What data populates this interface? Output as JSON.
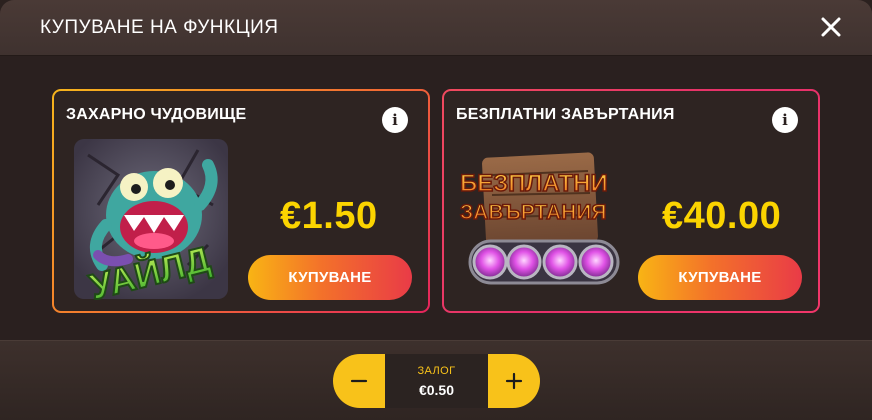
{
  "header": {
    "title": "КУПУВАНЕ НА ФУНКЦИЯ"
  },
  "cards": [
    {
      "title": "ЗАХАРНО ЧУДОВИЩЕ",
      "price": "€1.50",
      "button_label": "КУПУВАНЕ",
      "art_text": "УАЙЛД",
      "icon": "sugar-monster-wild-icon"
    },
    {
      "title": "БЕЗПЛАТНИ ЗАВЪРТАНИЯ",
      "price": "€40.00",
      "button_label": "КУПУВАНЕ",
      "art_text_line1": "БЕЗПЛАТНИ",
      "art_text_line2": "ЗАВЪРТАНИЯ",
      "icon": "free-spins-icon"
    }
  ],
  "stake": {
    "label": "ЗАЛОГ",
    "value": "€0.50"
  },
  "colors": {
    "accent": "#f8c21a",
    "price": "#fbd400",
    "background": "#2a201f"
  }
}
